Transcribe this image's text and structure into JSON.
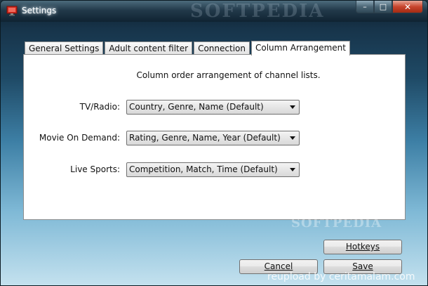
{
  "window": {
    "title": "Settings",
    "watermark_top": "SOFTPEDIA",
    "minimize_glyph": "–",
    "maximize_glyph": "□",
    "close_glyph": "✕"
  },
  "tabs": [
    {
      "label": "General Settings",
      "active": false
    },
    {
      "label": "Adult content filter",
      "active": false
    },
    {
      "label": "Connection",
      "active": false
    },
    {
      "label": "Column Arrangement",
      "active": true
    }
  ],
  "panel": {
    "heading": "Column order arrangement of channel lists.",
    "fields": [
      {
        "label": "TV/Radio:",
        "value": "Country, Genre, Name (Default)"
      },
      {
        "label": "Movie On Demand:",
        "value": "Rating, Genre, Name, Year (Default)"
      },
      {
        "label": "Live Sports:",
        "value": "Competition, Match, Time (Default)"
      }
    ]
  },
  "buttons": {
    "hotkeys": "Hotkeys",
    "cancel": "Cancel",
    "save": "Save"
  },
  "watermark_bottom": "SOFTPEDIA",
  "footer_text": "reupload by ceritamalam.com",
  "colors": {
    "close_button": "#c8452e",
    "app_icon": "#d42a1e"
  },
  "icons": {
    "app": "monitor-icon",
    "combo_arrow": "chevron-down-icon"
  }
}
